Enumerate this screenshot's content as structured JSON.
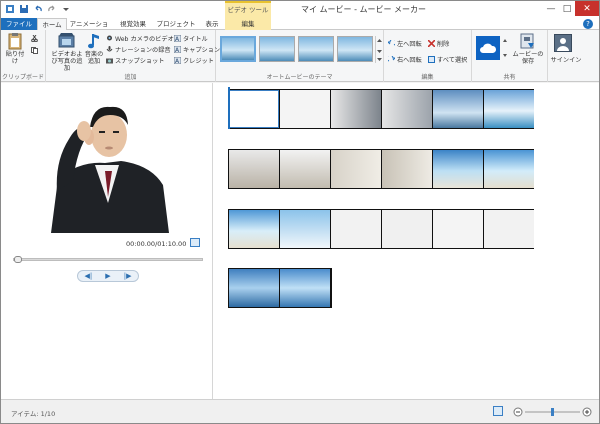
{
  "titlebar": {
    "context_tab_header": "ビデオ ツール",
    "title": "マイ ムービー - ムービー メーカー",
    "minimize": "—",
    "maximize": "□",
    "close": "✕"
  },
  "tabs": {
    "file": "ファイル",
    "home": "ホーム",
    "animations": "アニメーション",
    "visual_effects": "視覚効果",
    "project": "プロジェクト",
    "view": "表示",
    "edit": "編集",
    "help": "?"
  },
  "ribbon": {
    "clipboard": {
      "label": "クリップボード",
      "paste": "貼り付け"
    },
    "add": {
      "label": "追加",
      "add_videos_photos": "ビデオおよび写真の追加",
      "add_music": "音楽の追加",
      "webcam": "Web カメラのビデオ",
      "narration": "ナレーションの録音",
      "snapshot": "スナップショット",
      "title": "タイトル",
      "caption": "キャプション",
      "credits": "クレジット"
    },
    "themes": {
      "label": "オートムービーのテーマ"
    },
    "editing": {
      "label": "編集",
      "rotate_left": "左へ回転",
      "rotate_right": "右へ回転",
      "remove": "削除",
      "select_all": "すべて選択"
    },
    "share": {
      "label": "共有",
      "save_movie": "ムービーの保存",
      "sign_in": "サインイン"
    }
  },
  "preview": {
    "time": "00:00.00/01:10.00",
    "prev_frame": "◀|",
    "play": "▶",
    "next_frame": "|▶"
  },
  "status": {
    "items": "アイテム: 1/10"
  },
  "colors": {
    "accent": "#1e6fbd",
    "context_tab": "#fbe9a8",
    "close": "#c7312c"
  }
}
